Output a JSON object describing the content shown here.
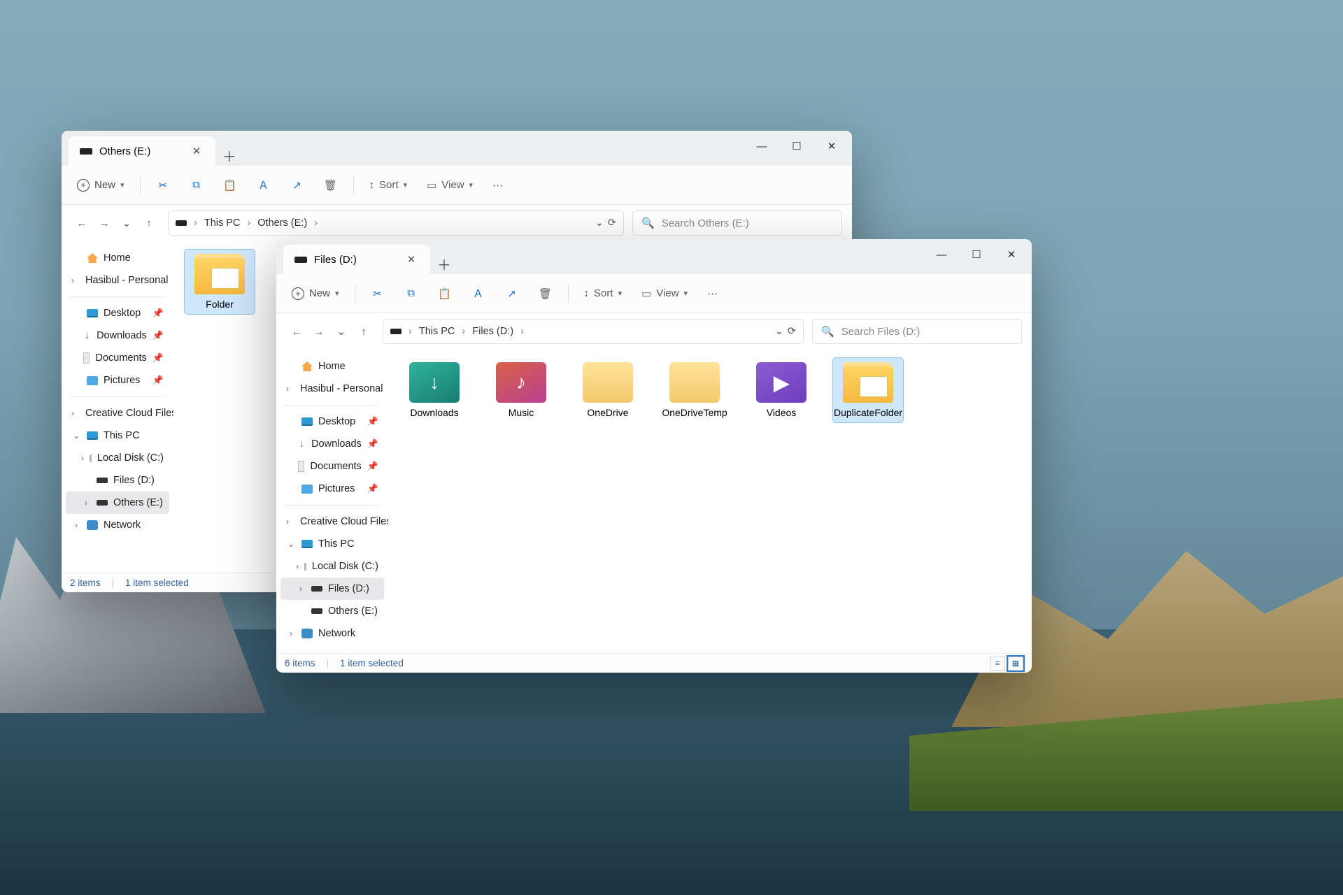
{
  "window1": {
    "tab_title": "Others (E:)",
    "toolbar": {
      "new": "New",
      "sort": "Sort",
      "view": "View"
    },
    "breadcrumb": [
      "This PC",
      "Others (E:)"
    ],
    "search_placeholder": "Search Others (E:)",
    "sidebar": {
      "home": "Home",
      "personal": "Hasibul - Personal",
      "desktop": "Desktop",
      "downloads": "Downloads",
      "documents": "Documents",
      "pictures": "Pictures",
      "ccf": "Creative Cloud Files",
      "thispc": "This PC",
      "localC": "Local Disk (C:)",
      "filesD": "Files (D:)",
      "othersE": "Others (E:)",
      "network": "Network"
    },
    "items": [
      {
        "label": "Folder",
        "selected": true
      }
    ],
    "status": {
      "count": "2 items",
      "sel": "1 item selected"
    }
  },
  "window2": {
    "tab_title": "Files (D:)",
    "toolbar": {
      "new": "New",
      "sort": "Sort",
      "view": "View"
    },
    "breadcrumb": [
      "This PC",
      "Files (D:)"
    ],
    "search_placeholder": "Search Files (D:)",
    "sidebar": {
      "home": "Home",
      "personal": "Hasibul - Personal",
      "desktop": "Desktop",
      "downloads": "Downloads",
      "documents": "Documents",
      "pictures": "Pictures",
      "ccf": "Creative Cloud Files",
      "thispc": "This PC",
      "localC": "Local Disk (C:)",
      "filesD": "Files (D:)",
      "othersE": "Others (E:)",
      "network": "Network"
    },
    "items": [
      {
        "label": "Downloads"
      },
      {
        "label": "Music"
      },
      {
        "label": "OneDrive"
      },
      {
        "label": "OneDriveTemp"
      },
      {
        "label": "Videos"
      },
      {
        "label": "DuplicateFolder",
        "selected": true
      }
    ],
    "status": {
      "count": "6 items",
      "sel": "1 item selected"
    }
  }
}
